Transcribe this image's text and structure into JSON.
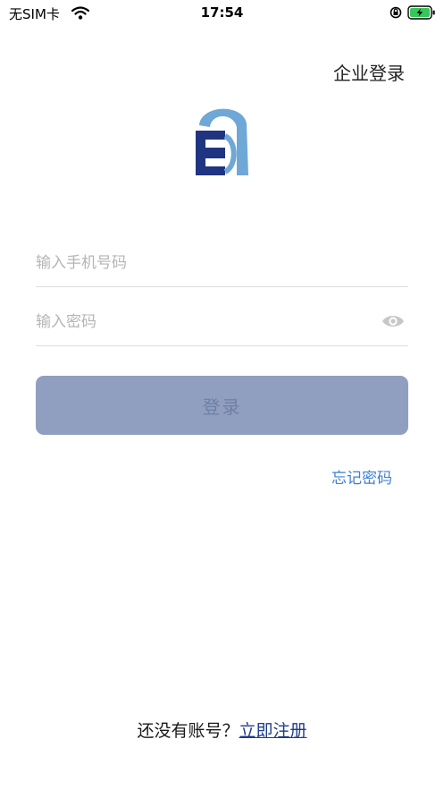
{
  "status_bar": {
    "carrier": "无SIM卡",
    "time": "17:54"
  },
  "header": {
    "enterprise_login": "企业登录"
  },
  "logo": {
    "letter": "E",
    "primary_color": "#1f3581",
    "secondary_color": "#6fa8d6"
  },
  "form": {
    "phone_placeholder": "输入手机号码",
    "password_placeholder": "输入密码",
    "login_label": "登录",
    "forgot_password": "忘记密码"
  },
  "footer": {
    "no_account_text": "还没有账号？",
    "register_link": "立即注册"
  },
  "colors": {
    "login_button_bg": "#909fc0",
    "link_blue": "#3f7fd6",
    "battery_green": "#34c759"
  }
}
